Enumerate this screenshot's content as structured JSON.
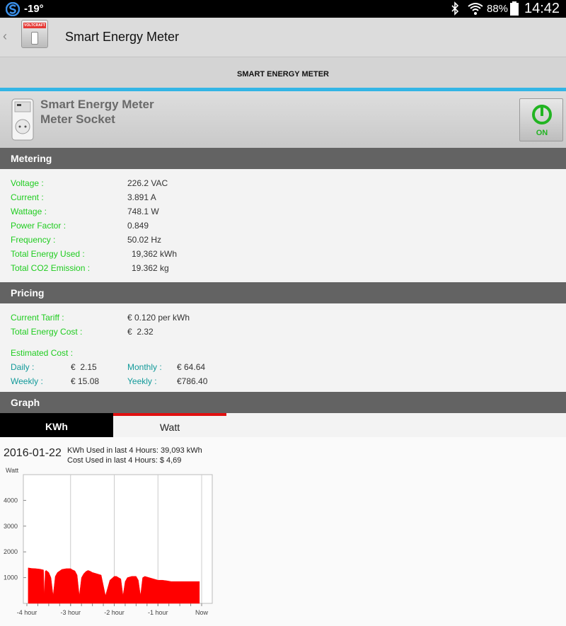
{
  "status_bar": {
    "temperature": "-19°",
    "battery": "88%",
    "time": "14:42"
  },
  "app_bar": {
    "brand": "VOLTCRAFT",
    "title": "Smart Energy Meter"
  },
  "tab": {
    "label": "SMART ENERGY METER",
    "accent": "#33b5e5"
  },
  "device": {
    "name": "Smart Energy Meter",
    "type": "Meter Socket",
    "power_label": "ON"
  },
  "metering": {
    "header": "Metering",
    "rows": [
      {
        "label": "Voltage :",
        "value": "226.2 VAC"
      },
      {
        "label": "Current :",
        "value": "3.891 A"
      },
      {
        "label": "Wattage :",
        "value": "748.1 W"
      },
      {
        "label": "Power Factor :",
        "value": "0.849"
      },
      {
        "label": "Frequency :",
        "value": "50.02 Hz"
      },
      {
        "label": "Total Energy Used :",
        "value": "19,362 kWh"
      },
      {
        "label": "Total CO2 Emission :",
        "value": "19.362 kg"
      }
    ]
  },
  "pricing": {
    "header": "Pricing",
    "tariff_label": "Current Tariff :",
    "tariff_value": "€ 0.120 per kWh",
    "cost_label": "Total Energy Cost :",
    "cost_value": "€  2.32",
    "estimated_label": "Estimated Cost :",
    "daily_label": "Daily :",
    "daily_value": "€  2.15",
    "monthly_label": "Monthly :",
    "monthly_value": "€ 64.64",
    "weekly_label": "Weekly :",
    "weekly_value": "€ 15.08",
    "yearly_label": "Yeekly :",
    "yearly_value": "€786.40"
  },
  "graph": {
    "header": "Graph",
    "tabs": {
      "kwh": "KWh",
      "watt": "Watt"
    },
    "date": "2016-01-22",
    "info1": "KWh Used in last 4 Hours: 39,093 kWh",
    "info2": "Cost Used in last 4 Hours: $  4,69"
  },
  "chart_data": {
    "type": "area",
    "ylabel": "Watt",
    "ylim": [
      0,
      5000
    ],
    "yticks": [
      "1000",
      "2000",
      "3000",
      "4000"
    ],
    "xticks": [
      "-4 hour",
      "-3 hour",
      "-2 hour",
      "-1 hour",
      "Now"
    ],
    "xlim": [
      -4,
      0
    ],
    "color": "#ff0000",
    "grid": true,
    "series": [
      {
        "x": [
          -3.97,
          -3.9,
          -3.8,
          -3.7,
          -3.62,
          -3.6,
          -3.58,
          -3.56,
          -3.5,
          -3.45,
          -3.4,
          -3.35,
          -3.3,
          -3.2,
          -3.1,
          -3.0,
          -2.95,
          -2.9,
          -2.85,
          -2.8,
          -2.75,
          -2.7,
          -2.65,
          -2.6,
          -2.55,
          -2.5,
          -2.4,
          -2.3,
          -2.2,
          -2.1,
          -2.0,
          -1.95,
          -1.9,
          -1.85,
          -1.8,
          -1.75,
          -1.7,
          -1.6,
          -1.5,
          -1.45,
          -1.4,
          -1.35,
          -1.3,
          -1.2,
          -1.1,
          -1.0,
          -0.9,
          -0.8,
          -0.7,
          -0.6,
          -0.5,
          -0.4,
          -0.3,
          -0.2,
          -0.1,
          -0.05
        ],
        "y": [
          1380,
          1360,
          1350,
          1330,
          1300,
          300,
          1250,
          1280,
          1200,
          1000,
          300,
          1050,
          1200,
          1320,
          1350,
          1350,
          1300,
          1260,
          1100,
          300,
          1000,
          1150,
          1240,
          1280,
          1250,
          1200,
          1150,
          1100,
          300,
          900,
          1050,
          1050,
          1000,
          950,
          300,
          850,
          1000,
          1050,
          1050,
          900,
          300,
          1000,
          1050,
          1000,
          950,
          900,
          900,
          880,
          850,
          850,
          850,
          850,
          850,
          850,
          850,
          850
        ]
      }
    ]
  }
}
